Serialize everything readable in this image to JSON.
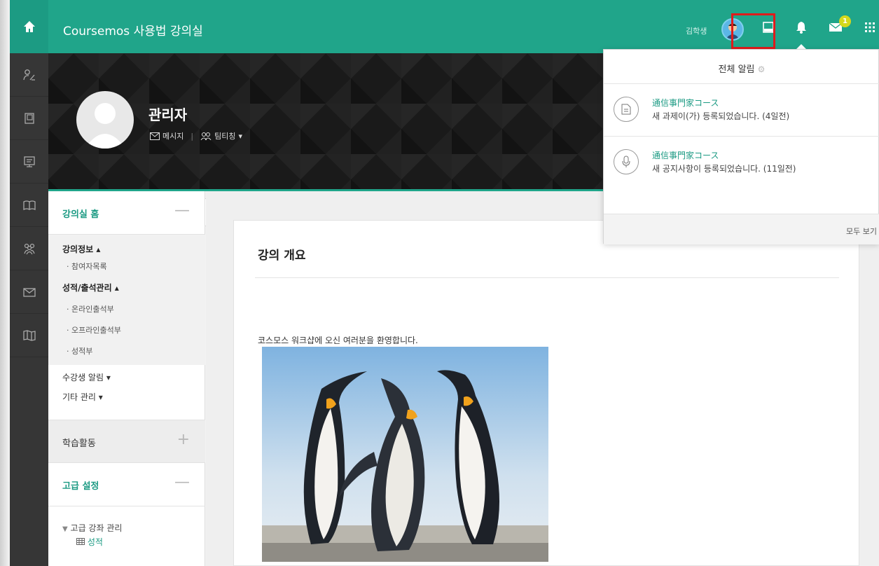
{
  "app": {
    "title": "Coursemos 사용법 강의실"
  },
  "topbar": {
    "user_name": "김학생",
    "icons": [
      "home-icon",
      "avatar",
      "screen-icon",
      "bell-icon",
      "mail-icon",
      "apps-grid-icon"
    ],
    "message_badge": "1",
    "accent_color": "#20a58a",
    "highlight_color": "#e01b1b"
  },
  "rail": {
    "icons": [
      "people-icon",
      "book-icon",
      "presentation-icon",
      "open-book-icon",
      "group-icon",
      "envelope-icon",
      "map-icon"
    ]
  },
  "profile": {
    "name": "관리자",
    "message_label": "메시지",
    "team_label": "팀티칭"
  },
  "sidebar": {
    "home_title": "강의실 홈",
    "sections": [
      {
        "label": "강의정보 ▴"
      },
      {
        "label": "· 참여자목록"
      },
      {
        "label": "성적/출석관리 ▴"
      },
      {
        "label": "· 온라인출석부"
      },
      {
        "label": "· 오프라인출석부"
      },
      {
        "label": "· 성적부"
      },
      {
        "label": "수강생 알림 ▾"
      },
      {
        "label": "기타 관리 ▾"
      }
    ],
    "activities_title": "학습활동",
    "advanced_title": "고급 설정",
    "advanced_item": "고급 강좌 관리",
    "grades_link": "성적"
  },
  "main": {
    "title": "강의 개요",
    "welcome": "코스모스 워크샵에 오신 여러분을 환영합니다."
  },
  "notifications": {
    "header": "전체 알림",
    "items": [
      {
        "course": "通信事門家コース",
        "message": "새 과제이(가) 등록되었습니다. (4일전)",
        "icon": "document-icon"
      },
      {
        "course": "通信事門家コース",
        "message": "새 공지사항이 등록되었습니다. (11일전)",
        "icon": "microphone-icon"
      }
    ],
    "view_all": "모두 보기"
  }
}
